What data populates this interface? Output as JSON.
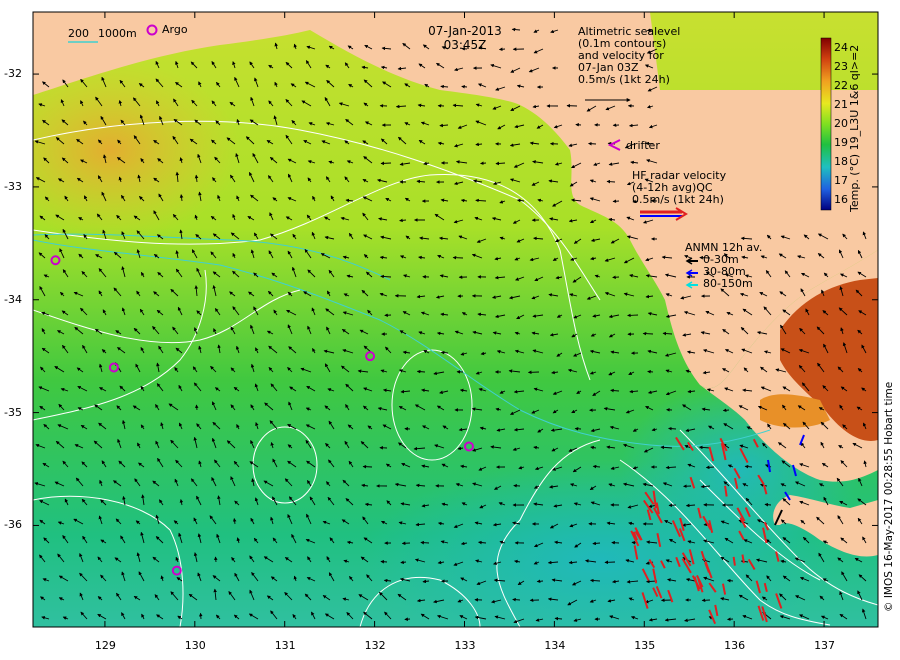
{
  "header": {
    "date": "07-Jan-2013",
    "time": "03:45Z"
  },
  "scale_legend": {
    "depth_200": "200",
    "depth_1000": "1000m",
    "argo_label": "Argo"
  },
  "altimetry_legend": {
    "lines": [
      "Altimetric sealevel",
      "(0.1m contours)",
      "and velocity for",
      "07-Jan 03Z",
      "0.5m/s (1kt 24h)"
    ]
  },
  "drifter_legend": {
    "label": "drifter"
  },
  "hf_radar_legend": {
    "lines": [
      "HF radar velocity",
      "(4-12h avg)QC",
      "0.5m/s (1kt 24h)"
    ]
  },
  "anmn_legend": {
    "title": "ANMN 12h av.",
    "items": [
      {
        "label": "0-30m",
        "color": "#000000"
      },
      {
        "label": "30-80m",
        "color": "#0000ff"
      },
      {
        "label": "80-150m",
        "color": "#00e0e0"
      }
    ]
  },
  "colorbar": {
    "title": "Temp. (°C) 19_L3U 1&6 ql>=2",
    "ticks": [
      "24",
      "23",
      "22",
      "21",
      "20",
      "19",
      "18",
      "17",
      "16"
    ],
    "min": 15.5,
    "max": 24.5
  },
  "axes": {
    "x_ticks": [
      "129",
      "130",
      "131",
      "132",
      "133",
      "134",
      "135",
      "136",
      "137"
    ],
    "y_ticks": [
      "-32",
      "-33",
      "-34",
      "-35",
      "-36"
    ],
    "x_range": [
      128.2,
      137.6
    ],
    "y_range": [
      -36.9,
      -31.45
    ]
  },
  "argo_floats": [
    {
      "lon": 128.45,
      "lat": -33.65
    },
    {
      "lon": 129.1,
      "lat": -34.6
    },
    {
      "lon": 131.95,
      "lat": -34.5
    },
    {
      "lon": 133.05,
      "lat": -35.3
    },
    {
      "lon": 129.8,
      "lat": -36.4
    }
  ],
  "credit": "© IMOS 16-May-2017 00:28:55 Hobart time",
  "colors": {
    "land": "#f9c9a2",
    "argo": "#cc00cc",
    "hf_radar": "#e02020",
    "contour": "#ffffff",
    "bathy_200": "#40d0d0"
  }
}
